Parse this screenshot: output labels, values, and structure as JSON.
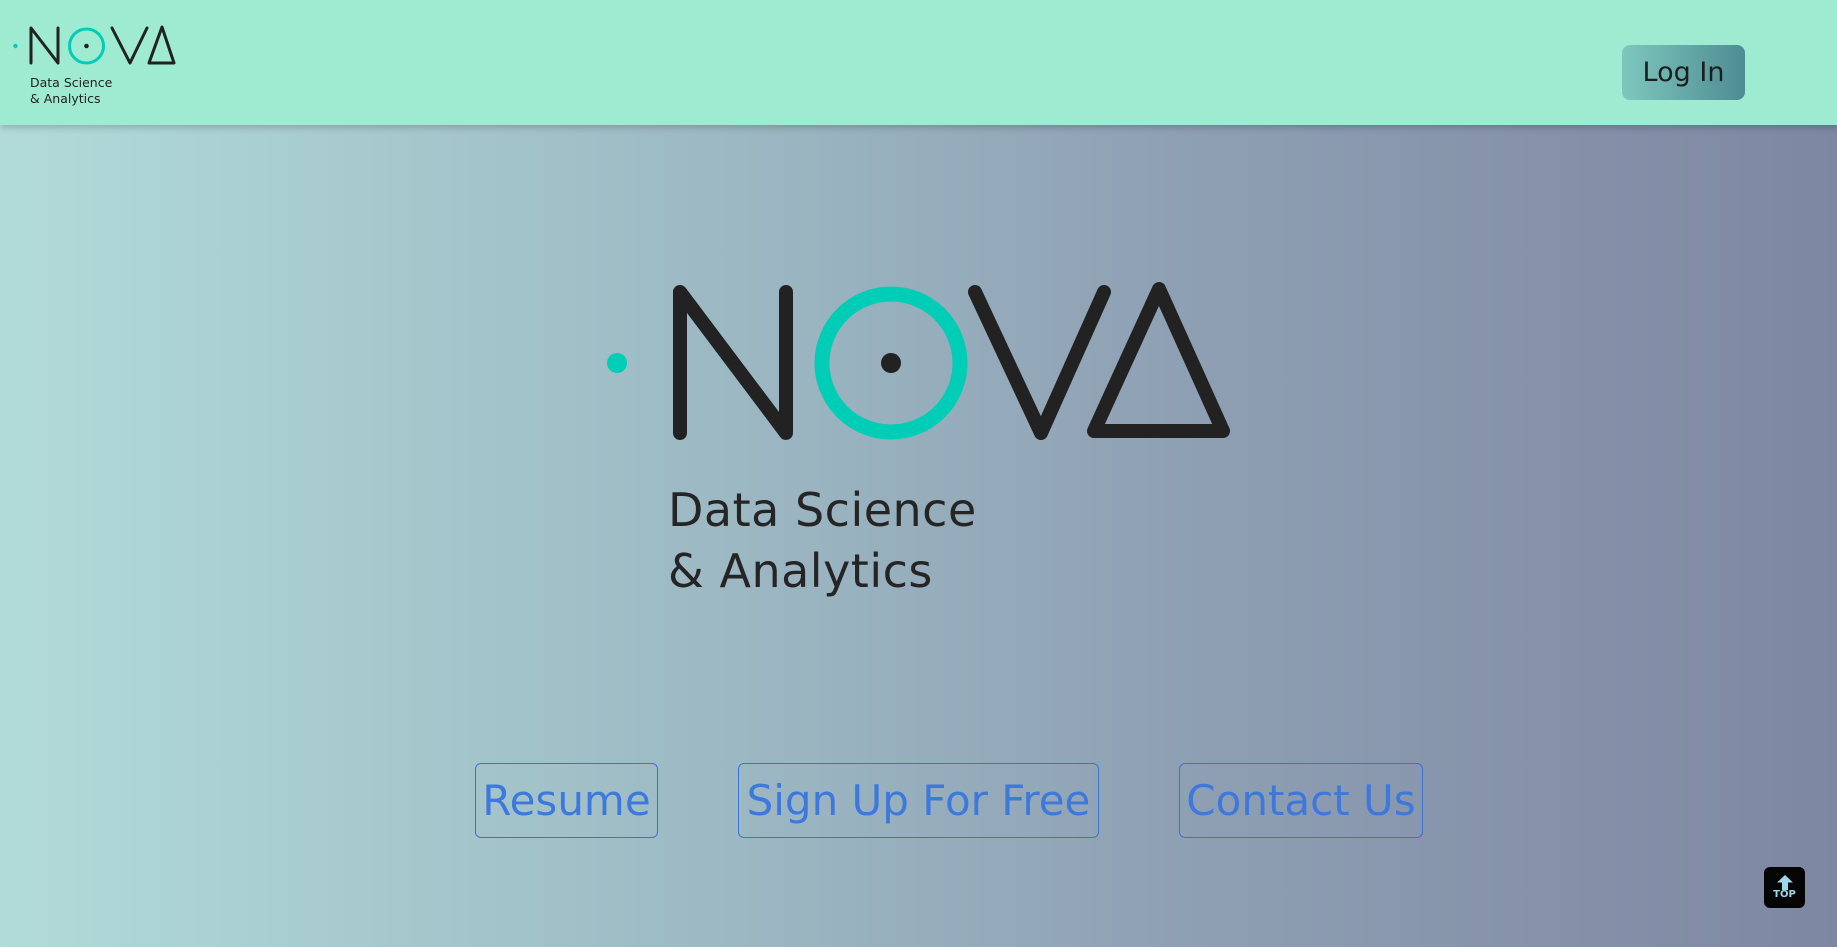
{
  "header": {
    "logo_text": "NOVA",
    "tagline_line1": "Data Science",
    "tagline_line2": "& Analytics",
    "login_label": "Log In"
  },
  "hero": {
    "logo_text": "NOVA",
    "tagline_line1": "Data Science",
    "tagline_line2": "& Analytics"
  },
  "actions": {
    "resume_label": "Resume",
    "signup_label": "Sign Up For Free",
    "contact_label": "Contact Us"
  },
  "scroll_top": {
    "label": "TOP",
    "icon": "arrow-up-icon"
  },
  "colors": {
    "header_bg": "#9eebd2",
    "accent_teal": "#00cdb5",
    "logo_dark": "#222222",
    "link_blue": "#3d78dc"
  }
}
